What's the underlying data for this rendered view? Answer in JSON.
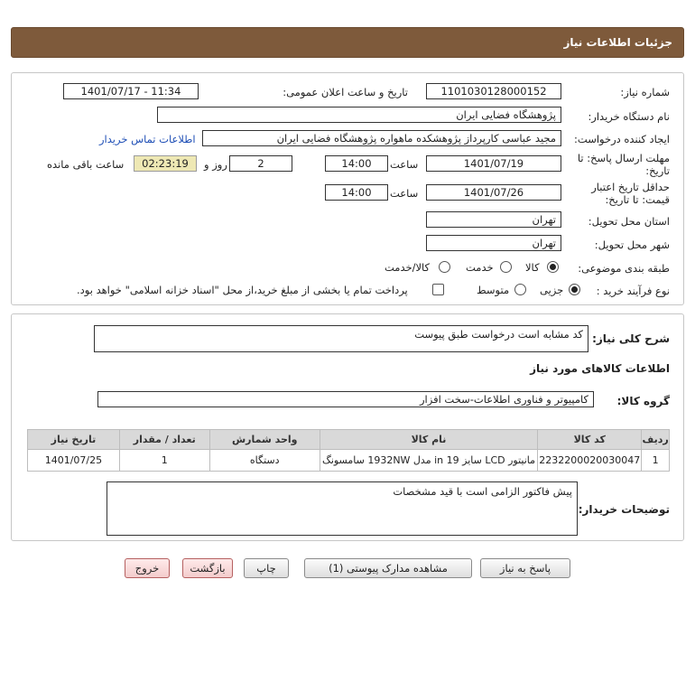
{
  "header": {
    "title": "جزئیات اطلاعات نیاز"
  },
  "form": {
    "need_number_label": "شماره نیاز:",
    "need_number": "1101030128000152",
    "announce_label": "تاریخ و ساعت اعلان عمومی:",
    "announce_value": "1401/07/17 - 11:34",
    "buyer_org_label": "نام دستگاه خریدار:",
    "buyer_org": "پژوهشگاه فضایی ایران",
    "creator_label": "ایجاد کننده درخواست:",
    "creator": "مجید عباسی کارپرداز پژوهشکده ماهواره پژوهشگاه فضایی ایران",
    "contact_link": "اطلاعات تماس خریدار",
    "reply_deadline_label_1": "مهلت ارسال پاسخ: تا",
    "reply_deadline_label_2": "تاریخ:",
    "reply_date": "1401/07/19",
    "time_label": "ساعت",
    "reply_time": "14:00",
    "days_value": "2",
    "days_label": "روز و",
    "remaining_time": "02:23:19",
    "remaining_label": "ساعت باقی مانده",
    "validity_label_1": "حداقل تاریخ اعتبار",
    "validity_label_2": "قیمت: تا تاریخ:",
    "validity_date": "1401/07/26",
    "validity_time_label": "ساعت",
    "validity_time": "14:00",
    "province_label": "استان محل تحویل:",
    "province": "تهران",
    "city_label": "شهر محل تحویل:",
    "city": "تهران",
    "category_label": "طبقه بندی موضوعی:",
    "category_options": [
      "کالا",
      "خدمت",
      "کالا/خدمت"
    ],
    "category_selected": "کالا",
    "process_label": "نوع فرآیند خرید :",
    "process_options": [
      "جزیی",
      "متوسط"
    ],
    "process_selected": "جزیی",
    "payment_note": "پرداخت تمام یا بخشی از مبلغ خرید،از محل \"اسناد خزانه اسلامی\" خواهد بود."
  },
  "details": {
    "summary_label": "شرح کلی نیاز:",
    "summary": "کد مشابه است درخواست طبق پیوست",
    "goods_info_title": "اطلاعات کالاهای مورد نیاز",
    "goods_group_label": "گروه کالا:",
    "goods_group": "کامپیوتر و فناوری اطلاعات-سخت افزار",
    "table": {
      "headers": [
        "ردیف",
        "کد کالا",
        "نام کالا",
        "واحد شمارش",
        "تعداد / مقدار",
        "تاریخ نیاز"
      ],
      "rows": [
        [
          "1",
          "2232200020030047",
          "مانیتور LCD سایز in 19 مدل 1932NW سامسونگ",
          "دستگاه",
          "1",
          "1401/07/25"
        ]
      ]
    },
    "buyer_notes_label": "توضیحات خریدار:",
    "buyer_notes": "پیش فاکتور الزامی است با قید مشخصات"
  },
  "buttons": {
    "reply": "پاسخ به نیاز",
    "view_docs": "مشاهده مدارک پیوستی (1)",
    "print": "چاپ",
    "back": "بازگشت",
    "exit": "خروج"
  },
  "colors": {
    "header_bg": "#7e5a3b",
    "link": "#1f4fb6",
    "remaining_bg": "#eee8b4"
  }
}
